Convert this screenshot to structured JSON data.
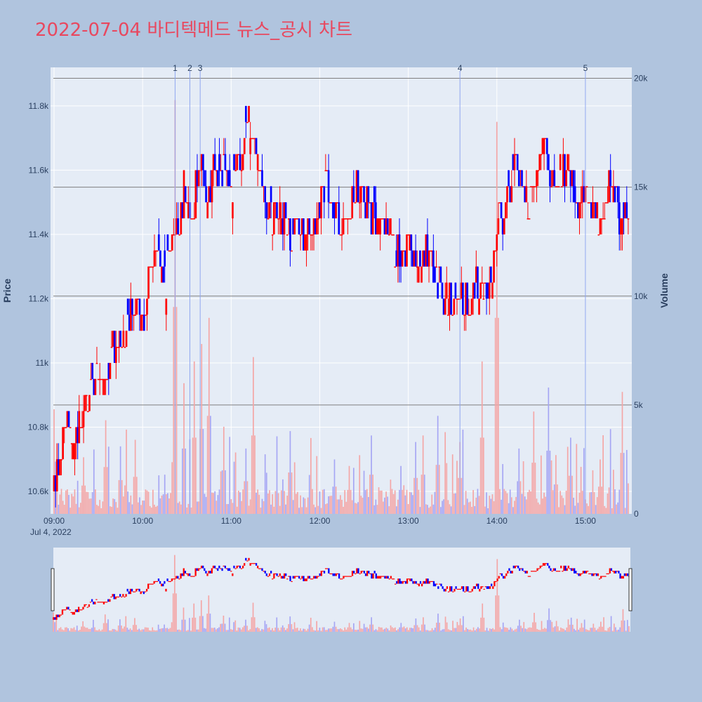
{
  "title": "2022-07-04 바디텍메드 뉴스_공시 차트",
  "colors": {
    "background": "#b0c4de",
    "plot_bg": "#e5ecf6",
    "title": "#e8485f",
    "up": "#ff0000",
    "down": "#0000ff",
    "volume_up": "#f4a6a6",
    "volume_down": "#a6a6f4",
    "hline": "#7f7f7f",
    "event_line": "#8fa6f0"
  },
  "chart_data": {
    "type": "candlestick",
    "title": "2022-07-04 바디텍메드 뉴스_공시 차트",
    "xaxis": {
      "ticks": [
        "09:00",
        "10:00",
        "11:00",
        "12:00",
        "13:00",
        "14:00",
        "15:00"
      ],
      "date_label": "Jul 4, 2022",
      "range": [
        "09:00",
        "15:30"
      ]
    },
    "yaxis_price": {
      "label": "Price",
      "ticks": [
        "10.6k",
        "10.8k",
        "11k",
        "11.2k",
        "11.4k",
        "11.6k",
        "11.8k"
      ],
      "range": [
        10530,
        11920
      ]
    },
    "yaxis_volume": {
      "label": "Volume",
      "ticks": [
        "0",
        "5k",
        "10k",
        "15k",
        "20k"
      ],
      "range": [
        0,
        20500
      ]
    },
    "volume_reference_lines": [
      5000,
      10000,
      15000,
      20000
    ],
    "events": [
      {
        "label": "1",
        "time": "10:22"
      },
      {
        "label": "2",
        "time": "10:32"
      },
      {
        "label": "3",
        "time": "10:39"
      },
      {
        "label": "4",
        "time": "13:35"
      },
      {
        "label": "5",
        "time": "15:00"
      }
    ],
    "price_path": [
      [
        "09:00",
        10600
      ],
      [
        "09:04",
        10700
      ],
      [
        "09:08",
        10850
      ],
      [
        "09:12",
        10750
      ],
      [
        "09:16",
        10800
      ],
      [
        "09:20",
        10800
      ],
      [
        "09:24",
        10900
      ],
      [
        "09:28",
        11000
      ],
      [
        "09:32",
        10950
      ],
      [
        "09:36",
        10950
      ],
      [
        "09:40",
        11050
      ],
      [
        "09:44",
        11050
      ],
      [
        "09:48",
        11100
      ],
      [
        "09:52",
        11150
      ],
      [
        "09:56",
        11200
      ],
      [
        "10:00",
        11150
      ],
      [
        "10:04",
        11250
      ],
      [
        "10:08",
        11350
      ],
      [
        "10:12",
        11300
      ],
      [
        "10:16",
        11250
      ],
      [
        "10:20",
        11400
      ],
      [
        "10:24",
        11450
      ],
      [
        "10:28",
        11550
      ],
      [
        "10:32",
        11400
      ],
      [
        "10:36",
        11550
      ],
      [
        "10:40",
        11600
      ],
      [
        "10:44",
        11500
      ],
      [
        "10:48",
        11600
      ],
      [
        "10:52",
        11550
      ],
      [
        "10:56",
        11600
      ],
      [
        "11:00",
        11550
      ],
      [
        "11:04",
        11600
      ],
      [
        "11:08",
        11650
      ],
      [
        "11:12",
        11750
      ],
      [
        "11:16",
        11650
      ],
      [
        "11:20",
        11550
      ],
      [
        "11:24",
        11500
      ],
      [
        "11:28",
        11450
      ],
      [
        "11:32",
        11500
      ],
      [
        "11:36",
        11450
      ],
      [
        "11:40",
        11400
      ],
      [
        "11:44",
        11450
      ],
      [
        "11:48",
        11400
      ],
      [
        "11:52",
        11400
      ],
      [
        "11:56",
        11400
      ],
      [
        "12:00",
        11500
      ],
      [
        "12:04",
        11550
      ],
      [
        "12:08",
        11500
      ],
      [
        "12:12",
        11450
      ],
      [
        "12:16",
        11450
      ],
      [
        "12:20",
        11450
      ],
      [
        "12:24",
        11550
      ],
      [
        "12:28",
        11500
      ],
      [
        "12:32",
        11500
      ],
      [
        "12:36",
        11450
      ],
      [
        "12:40",
        11450
      ],
      [
        "12:44",
        11400
      ],
      [
        "12:48",
        11400
      ],
      [
        "12:52",
        11350
      ],
      [
        "12:56",
        11300
      ],
      [
        "13:00",
        11400
      ],
      [
        "13:04",
        11300
      ],
      [
        "13:08",
        11300
      ],
      [
        "13:12",
        11350
      ],
      [
        "13:16",
        11300
      ],
      [
        "13:20",
        11250
      ],
      [
        "13:24",
        11200
      ],
      [
        "13:28",
        11200
      ],
      [
        "13:32",
        11150
      ],
      [
        "13:36",
        11200
      ],
      [
        "13:40",
        11200
      ],
      [
        "13:44",
        11250
      ],
      [
        "13:48",
        11250
      ],
      [
        "13:52",
        11250
      ],
      [
        "13:56",
        11200
      ],
      [
        "14:00",
        11450
      ],
      [
        "14:04",
        11400
      ],
      [
        "14:08",
        11550
      ],
      [
        "14:12",
        11600
      ],
      [
        "14:16",
        11550
      ],
      [
        "14:20",
        11500
      ],
      [
        "14:24",
        11500
      ],
      [
        "14:28",
        11600
      ],
      [
        "14:32",
        11700
      ],
      [
        "14:36",
        11600
      ],
      [
        "14:40",
        11550
      ],
      [
        "14:44",
        11600
      ],
      [
        "14:48",
        11650
      ],
      [
        "14:52",
        11550
      ],
      [
        "14:56",
        11500
      ],
      [
        "15:00",
        11550
      ],
      [
        "15:04",
        11500
      ],
      [
        "15:08",
        11450
      ],
      [
        "15:12",
        11500
      ],
      [
        "15:16",
        11550
      ],
      [
        "15:20",
        11500
      ],
      [
        "15:24",
        11450
      ],
      [
        "15:30",
        11450
      ]
    ],
    "volume_peaks": [
      [
        "09:00",
        4800
      ],
      [
        "09:20",
        2600
      ],
      [
        "09:35",
        4300
      ],
      [
        "09:45",
        3100
      ],
      [
        "09:55",
        3400
      ],
      [
        "10:15",
        1800
      ],
      [
        "10:22",
        19000
      ],
      [
        "10:28",
        6000
      ],
      [
        "10:35",
        7000
      ],
      [
        "10:40",
        7800
      ],
      [
        "10:45",
        9000
      ],
      [
        "10:55",
        4000
      ],
      [
        "11:10",
        3000
      ],
      [
        "11:15",
        7200
      ],
      [
        "11:40",
        3800
      ],
      [
        "12:10",
        2500
      ],
      [
        "12:20",
        2200
      ],
      [
        "12:35",
        3600
      ],
      [
        "12:55",
        2200
      ],
      [
        "13:05",
        3300
      ],
      [
        "13:10",
        3600
      ],
      [
        "13:20",
        4500
      ],
      [
        "13:35",
        3300
      ],
      [
        "13:50",
        7000
      ],
      [
        "14:00",
        18000
      ],
      [
        "14:15",
        3000
      ],
      [
        "14:25",
        4700
      ],
      [
        "14:35",
        5800
      ],
      [
        "14:40",
        2700
      ],
      [
        "14:50",
        3500
      ],
      [
        "15:05",
        2000
      ],
      [
        "15:10",
        2500
      ],
      [
        "15:25",
        5600
      ]
    ]
  }
}
